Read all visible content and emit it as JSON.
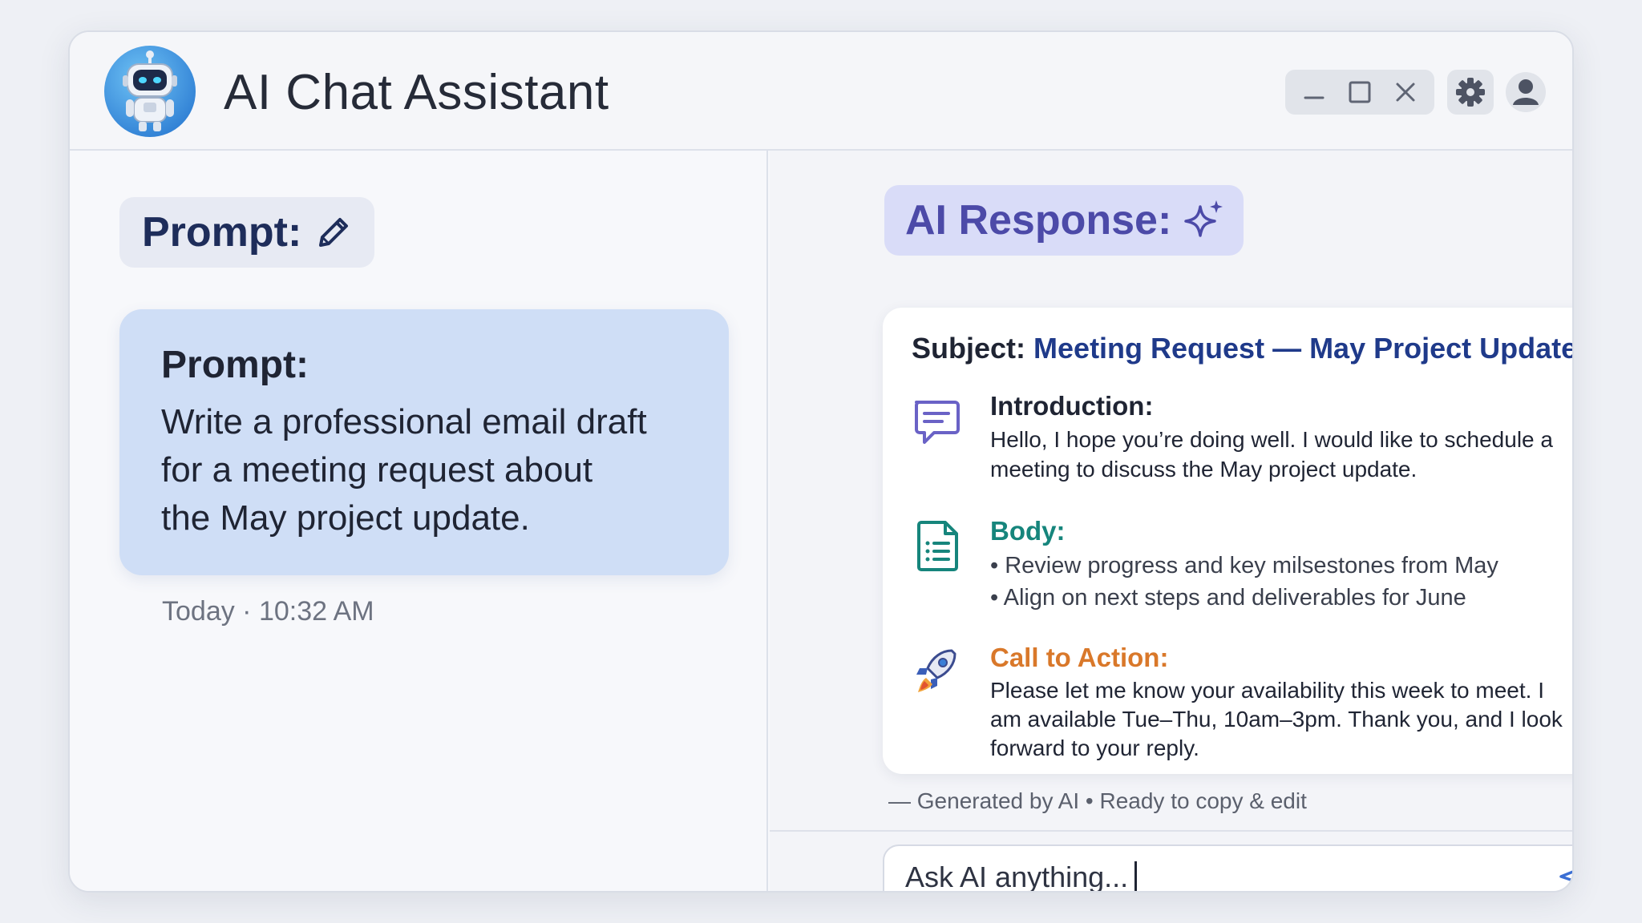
{
  "window": {
    "title": "AI Chat Assistant",
    "controls": {
      "minimize_icon": "minimize-icon",
      "maximize_icon": "maximize-icon",
      "close_icon": "close-icon",
      "settings_icon": "gear-icon",
      "account_icon": "user-icon"
    }
  },
  "left_pane": {
    "chip_label": "Prompt:",
    "chip_icon": "pencil-icon",
    "bubble": {
      "title": "Prompt:",
      "lines": [
        "Write a professional email draft",
        "for a meeting request about",
        "the May project update."
      ]
    },
    "timestamp": "Today · 10:32 AM"
  },
  "right_pane": {
    "chip_label": "AI Response:",
    "chip_icon": "sparkle-icon",
    "card": {
      "subject_label": "Subject:",
      "subject_value": "Meeting Request — May Project Update",
      "introduction": {
        "icon": "chat-bubble-icon",
        "heading": "Introduction:",
        "lines": [
          "Hello, I hope you’re doing well. I would like to schedule a",
          "meeting to discuss the May project update."
        ]
      },
      "body": {
        "icon": "document-list-icon",
        "heading": "Body:",
        "bullets": [
          "• Review progress and key milsestones from May",
          "• Align on next steps and deliverables for June"
        ]
      },
      "call_to_action": {
        "icon": "rocket-icon",
        "heading": "Call to Action:",
        "lines": [
          "Please let me know your availability this week to meet. I",
          "am available Tue–Thu, 10am–3pm. Thank you, and I look",
          "forward to your reply."
        ]
      }
    },
    "footnote": "— Generated by AI • Ready to copy & edit",
    "input": {
      "value": "Ask AI anything...",
      "send_icon": "send-icon"
    }
  },
  "colors": {
    "accent_blue": "#1f3a8a",
    "body_teal": "#16857c",
    "cta_orange": "#d9782a",
    "response_purple": "#4c4aa8",
    "prompt_bubble": "#cfdef6"
  }
}
